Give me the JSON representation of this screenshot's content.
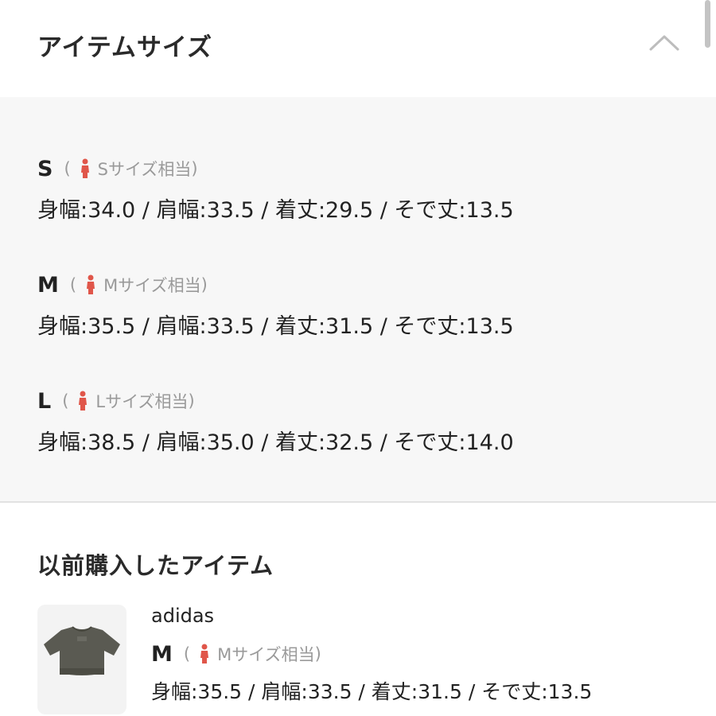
{
  "header": {
    "title": "アイテムサイズ",
    "collapse_icon": "chevron-up-icon"
  },
  "sizes": [
    {
      "label": "S",
      "open_paren": "(",
      "equiv": "Sサイズ相当",
      "close_paren": ")",
      "measurements": "身幅:34.0 / 肩幅:33.5 / 着丈:29.5 / そで丈:13.5"
    },
    {
      "label": "M",
      "open_paren": "(",
      "equiv": "Mサイズ相当",
      "close_paren": ")",
      "measurements": "身幅:35.5 / 肩幅:33.5 / 着丈:31.5 / そで丈:13.5"
    },
    {
      "label": "L",
      "open_paren": "(",
      "equiv": "Lサイズ相当",
      "close_paren": ")",
      "measurements": "身幅:38.5 / 肩幅:35.0 / 着丈:32.5 / そで丈:14.0"
    }
  ],
  "previous": {
    "title": "以前購入したアイテム",
    "brand": "adidas",
    "size_label": "M",
    "open_paren": "(",
    "equiv": "Mサイズ相当",
    "close_paren": ")",
    "measurements": "身幅:35.5 / 肩幅:33.5 / 着丈:31.5 / そで丈:13.5"
  },
  "colors": {
    "person_icon": "#e0564a",
    "panel_bg": "#f7f7f7",
    "muted_text": "#9a9a9a"
  }
}
